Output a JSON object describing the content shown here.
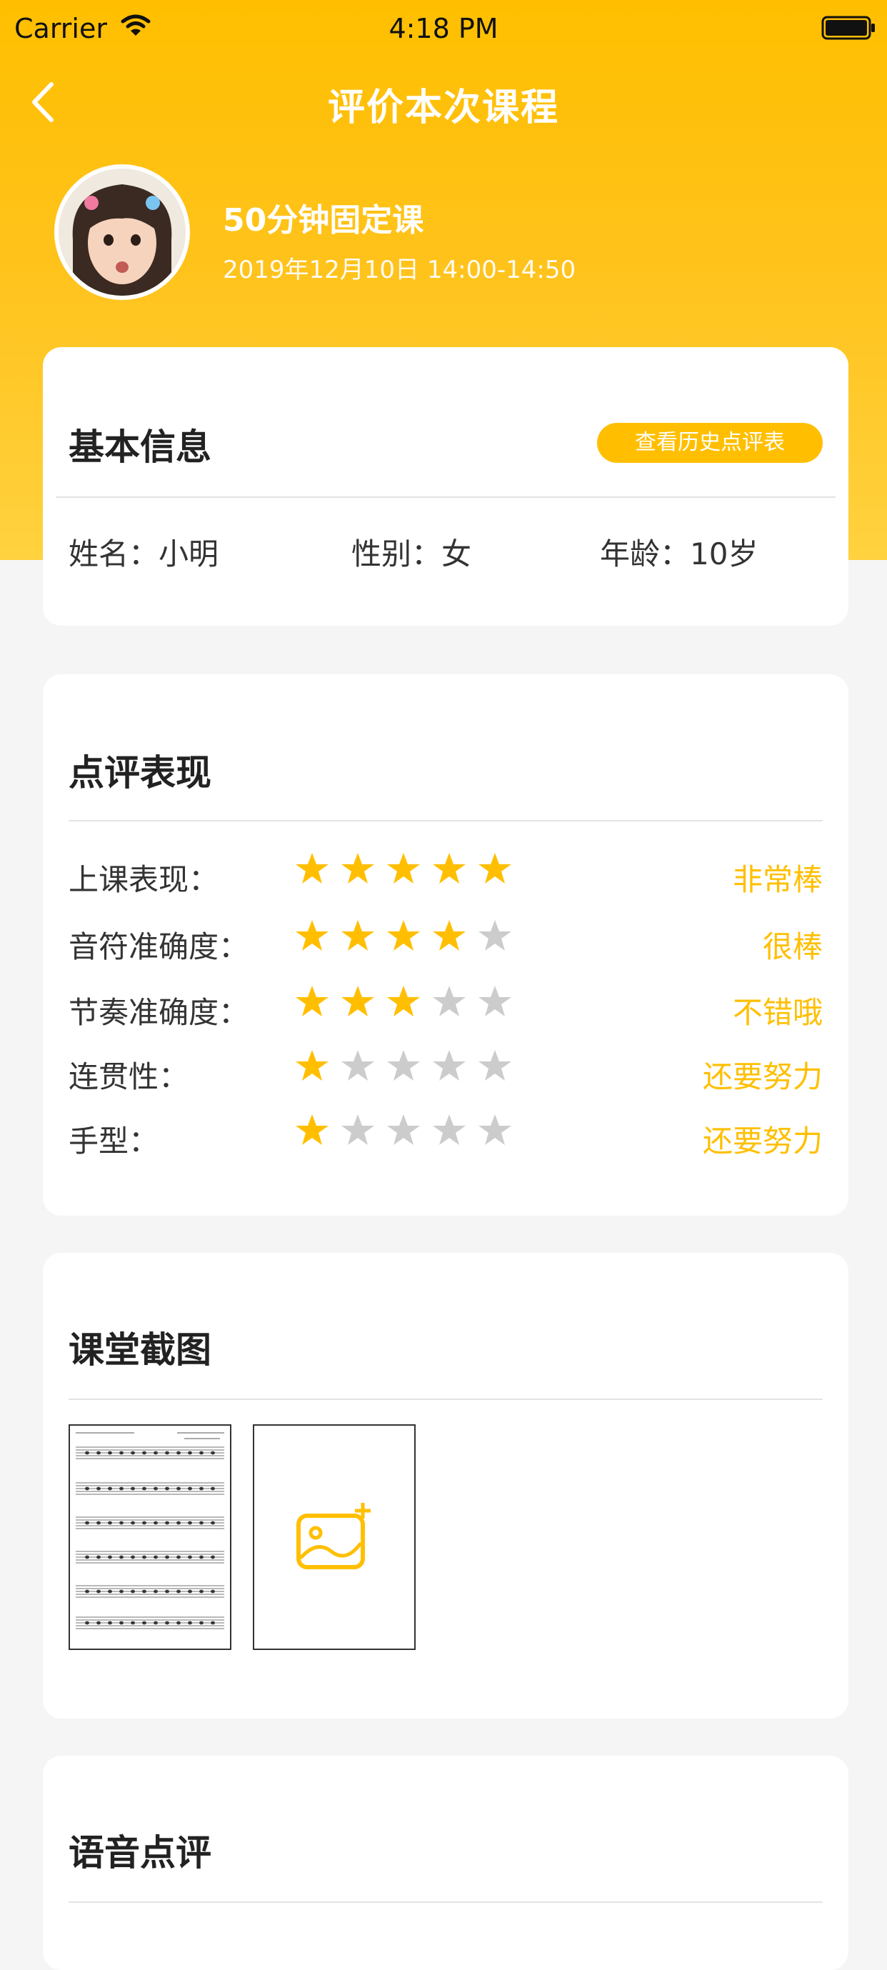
{
  "status_bar": {
    "carrier": "Carrier",
    "time": "4:18 PM"
  },
  "nav": {
    "title": "评价本次课程"
  },
  "course": {
    "name": "50分钟固定课",
    "datetime": "2019年12月10日 14:00-14:50"
  },
  "basic_info": {
    "title": "基本信息",
    "history_button": "查看历史点评表",
    "name": "姓名：小明",
    "gender": "性别：女",
    "age": "年龄：10岁"
  },
  "review": {
    "title": "点评表现",
    "rows": [
      {
        "label": "上课表现：",
        "stars": 5,
        "value": "非常棒"
      },
      {
        "label": "音符准确度：",
        "stars": 4,
        "value": "很棒"
      },
      {
        "label": "节奏准确度：",
        "stars": 3,
        "value": "不错哦"
      },
      {
        "label": "连贯性：",
        "stars": 1,
        "value": "还要努力"
      },
      {
        "label": "手型：",
        "stars": 1,
        "value": "还要努力"
      }
    ],
    "max_stars": 5
  },
  "screenshots": {
    "title": "课堂截图"
  },
  "voice": {
    "title": "语音点评"
  },
  "colors": {
    "accent": "#ffbf00",
    "star_on": "#ffbf00",
    "star_off": "#cccccc"
  },
  "icons": [
    "back-chevron-icon",
    "wifi-icon",
    "battery-icon",
    "star-icon",
    "add-photo-icon"
  ]
}
